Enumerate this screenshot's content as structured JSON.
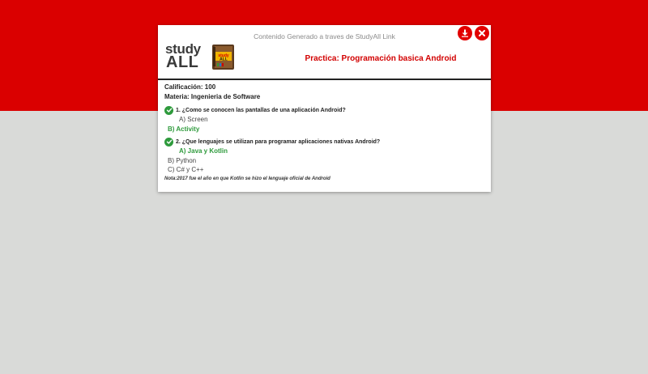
{
  "header": {
    "generated_by": "Contenido Generado a traves de StudyAll Link",
    "logo_top": "study",
    "logo_bottom": "ALL",
    "book_label_top": "study",
    "book_label_bottom": "ALL",
    "page_title": "Practica: Programación basica Android"
  },
  "meta": {
    "grade": "Calificación: 100",
    "subject": "Materia: Ingenieria de Software"
  },
  "questions": [
    {
      "text": "1. ¿Como se conocen las pantallas de una aplicación Android?",
      "options": [
        "A) Screen",
        "B) Activity"
      ]
    },
    {
      "text": "2. ¿Que lenguajes se utilizan para programar aplicaciones nativas Android?",
      "options": [
        "A) Java y Kotlin",
        "B) Python",
        "C) C# y C++"
      ]
    }
  ],
  "note": "Nota:2017 fue el año en que Kotlin se hizo el lenguaje oficial de Android",
  "colors": {
    "brand_red": "#da0000",
    "correct_green": "#2e9a3c",
    "background_gray": "#d9dad8"
  },
  "icons": [
    "download-icon",
    "close-icon",
    "check-circle-icon",
    "book-icon"
  ]
}
